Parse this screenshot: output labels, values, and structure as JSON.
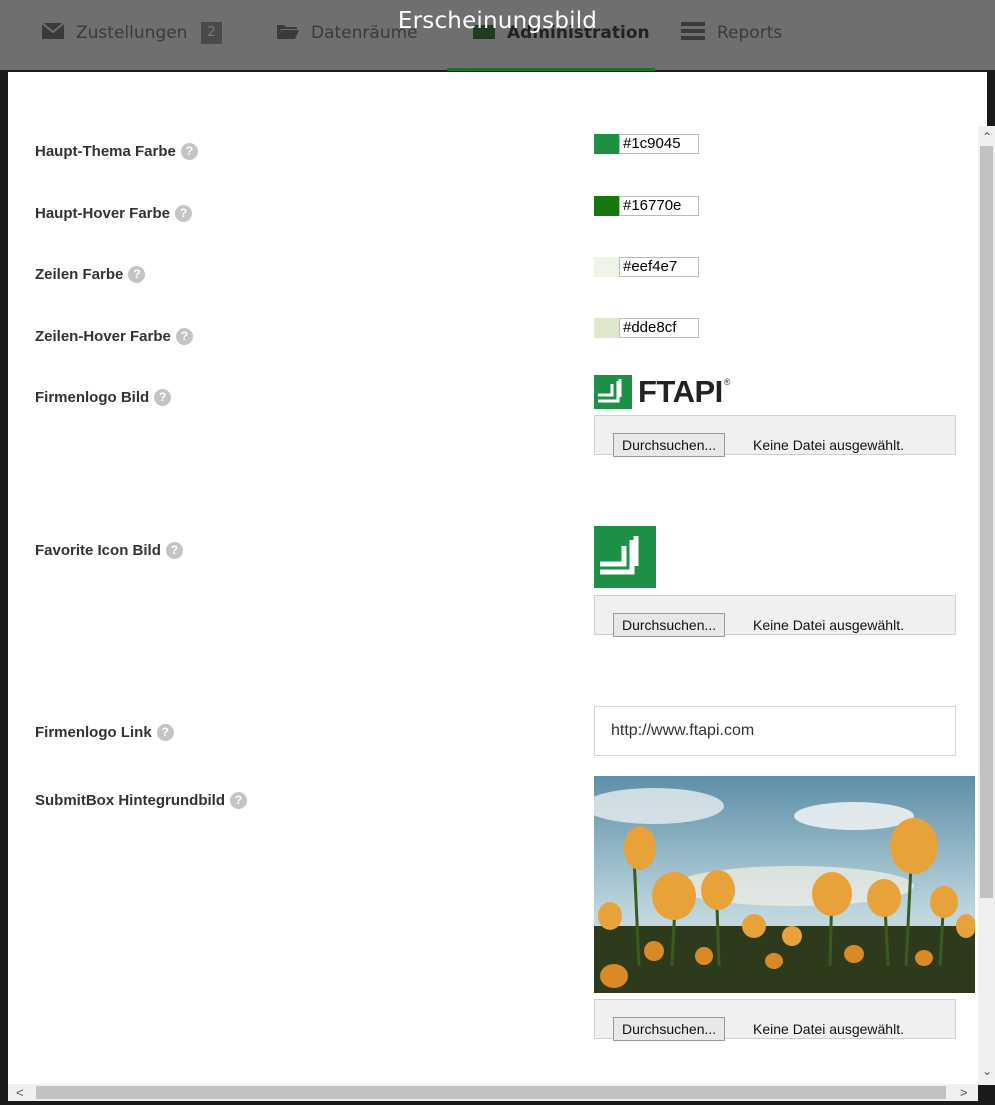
{
  "nav": {
    "items": [
      {
        "label": "Zustellungen",
        "badge": "2",
        "icon": "envelope-icon"
      },
      {
        "label": "Datenräume",
        "icon": "folder-icon"
      },
      {
        "label": "Administration",
        "icon": "admin-icon"
      },
      {
        "label": "Reports",
        "icon": "reports-icon"
      }
    ]
  },
  "modal": {
    "title": "Erscheinungsbild"
  },
  "fields": {
    "haupt_thema": {
      "label": "Haupt-Thema Farbe",
      "value": "#1c9045",
      "color": "#1c9045"
    },
    "haupt_hover": {
      "label": "Haupt-Hover Farbe",
      "value": "#16770e",
      "color": "#16770e"
    },
    "zeilen": {
      "label": "Zeilen Farbe",
      "value": "#eef4e7",
      "color": "#eef4e7"
    },
    "zeilen_hover": {
      "label": "Zeilen-Hover Farbe",
      "value": "#dde8cf",
      "color": "#dde8cf"
    },
    "firmenlogo_bild": {
      "label": "Firmenlogo Bild",
      "logo_text": "FTAPI"
    },
    "favicon_bild": {
      "label": "Favorite Icon Bild"
    },
    "firmenlogo_link": {
      "label": "Firmenlogo Link",
      "value": "http://www.ftapi.com"
    },
    "submitbox_bild": {
      "label": "SubmitBox Hintegrundbild"
    }
  },
  "file_input": {
    "button_label": "Durchsuchen...",
    "status": "Keine Datei ausgewählt."
  },
  "brand_color": "#1c9045"
}
